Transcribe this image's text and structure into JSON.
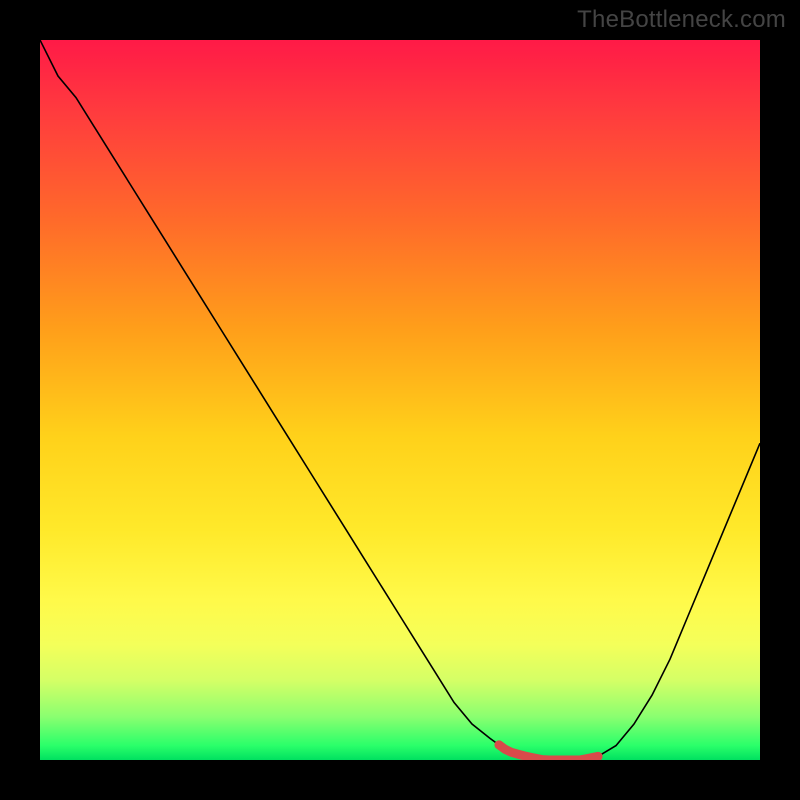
{
  "watermark": "TheBottleneck.com",
  "chart_data": {
    "type": "line",
    "x": [
      0,
      1,
      2,
      3,
      4,
      5,
      6,
      7,
      8,
      9,
      10,
      11,
      12,
      13,
      14,
      15,
      16,
      17,
      18,
      19,
      20,
      21,
      22,
      23,
      24,
      25,
      26,
      27,
      28,
      29,
      30,
      31,
      32,
      33,
      34,
      35,
      36,
      37,
      38,
      39,
      40
    ],
    "y": [
      100,
      95,
      92,
      88,
      84,
      80,
      76,
      72,
      68,
      64,
      60,
      56,
      52,
      48,
      44,
      40,
      36,
      32,
      28,
      24,
      20,
      16,
      12,
      8,
      5,
      3,
      1.2,
      0.5,
      0,
      0,
      0,
      0.5,
      2,
      5,
      9,
      14,
      20,
      26,
      32,
      38,
      44
    ],
    "xlim": [
      0,
      40
    ],
    "ylim": [
      0,
      100
    ],
    "highlight_range_x": [
      25.5,
      31
    ],
    "title": "",
    "xlabel": "",
    "ylabel": "",
    "grid": false
  },
  "colors": {
    "gradient_top": "#ff1a47",
    "gradient_mid": "#ffe92a",
    "gradient_bottom": "#00e060",
    "curve": "#000000",
    "highlight": "#d94a4a",
    "watermark": "#444444",
    "frame": "#000000"
  }
}
